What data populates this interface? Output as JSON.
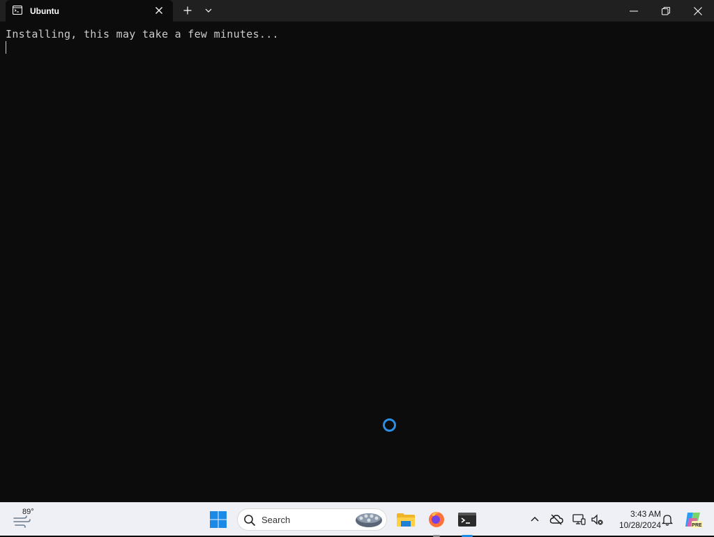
{
  "window": {
    "tab_title": "Ubuntu"
  },
  "terminal": {
    "output_line": "Installing, this may take a few minutes..."
  },
  "taskbar": {
    "weather_temp": "89°",
    "search_label": "Search",
    "clock_time": "3:43 AM",
    "clock_date": "10/28/2024",
    "copilot_badge": "PRE"
  },
  "icons": {
    "tab": "terminal-icon",
    "close": "close-icon",
    "new_tab": "plus-icon",
    "dropdown": "chevron-down-icon",
    "minimize": "minimize-icon",
    "maximize": "restore-icon",
    "window_close": "close-icon",
    "weather": "wind-icon",
    "start": "windows-logo-icon",
    "search": "search-icon",
    "explorer": "folder-icon",
    "firefox": "firefox-icon",
    "terminal_app": "terminal-icon",
    "tray_chevron": "chevron-up-icon",
    "cloud": "cloud-icon",
    "display": "display-icon",
    "sound": "sound-muted-icon",
    "notifications": "bell-icon",
    "copilot": "copilot-icon",
    "spinner": "loading-spinner-icon"
  },
  "colors": {
    "terminal_bg": "#0c0c0c",
    "titlebar_bg": "#202020",
    "terminal_text": "#cccccc",
    "accent": "#2b8fe6",
    "taskbar_bg": "#eef0f5"
  }
}
